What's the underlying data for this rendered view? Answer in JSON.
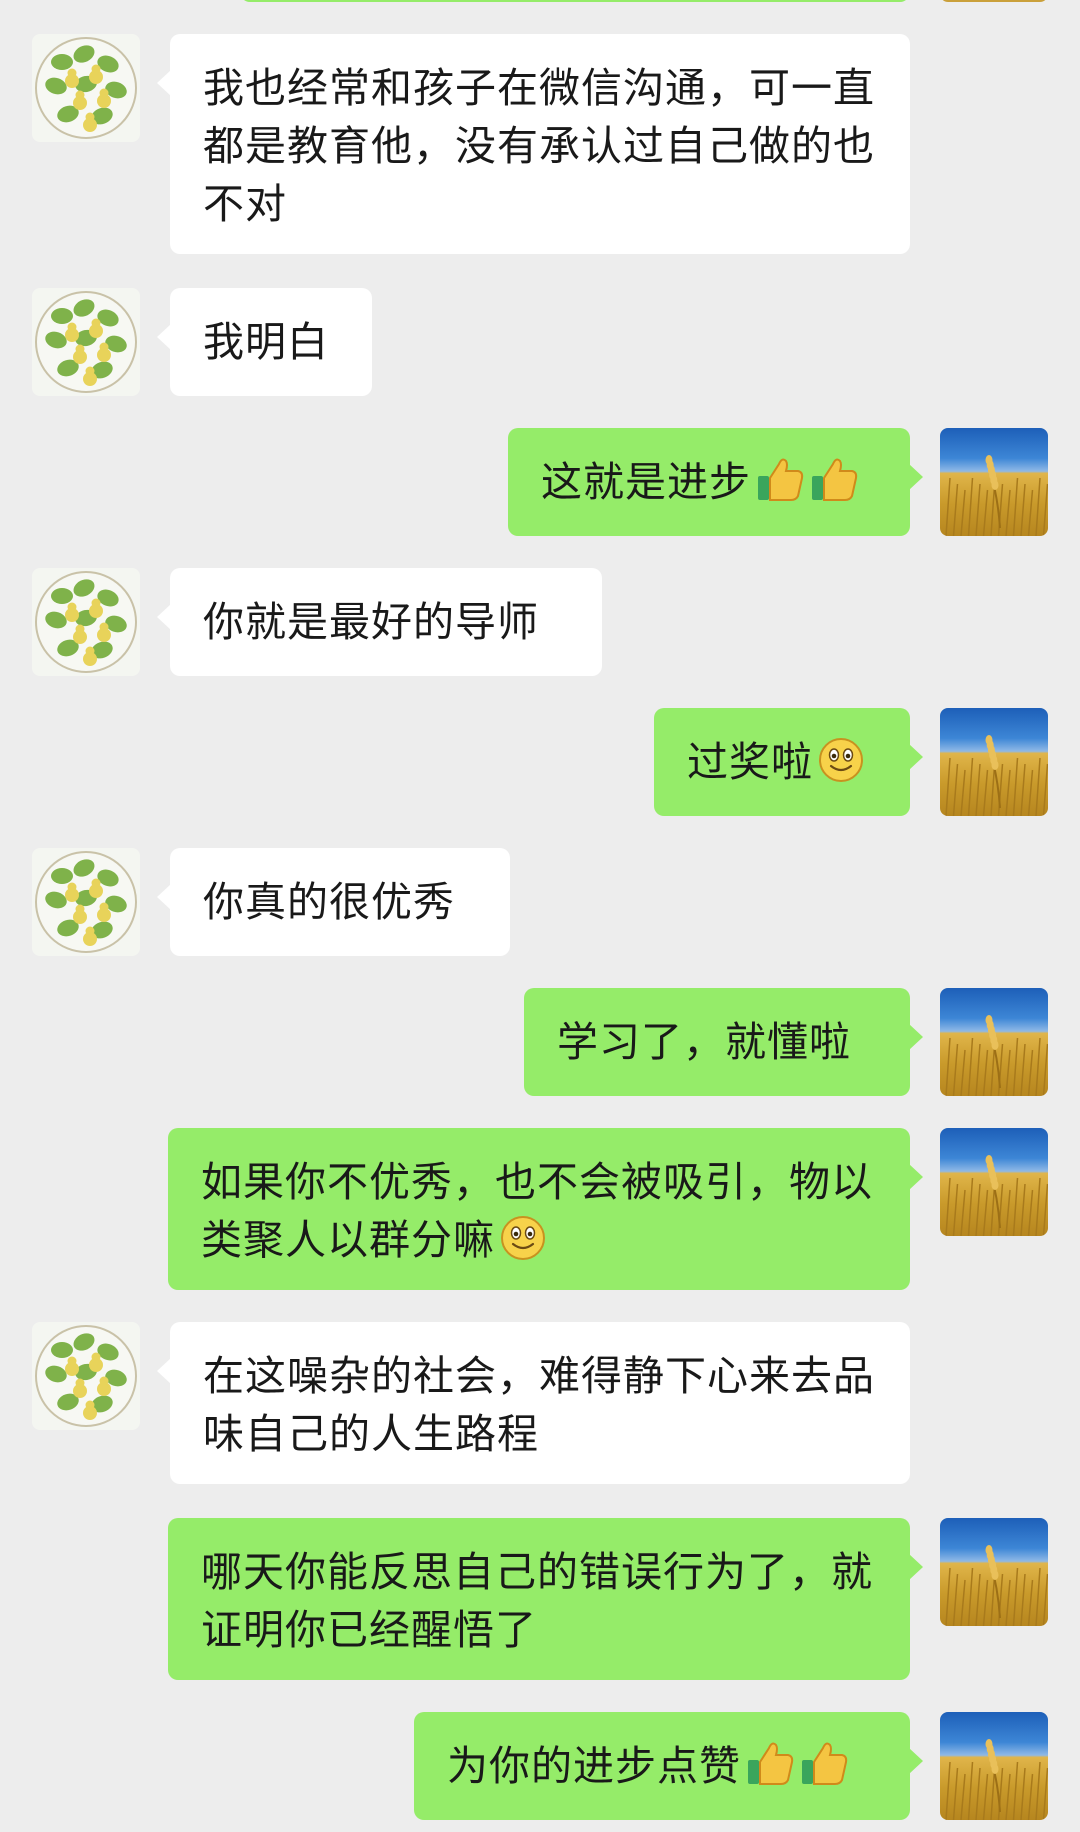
{
  "messages": [
    {
      "side": "in",
      "text": "我也经常和孩子在微信沟通，可一直都是教育他，没有承认过自己做的也不对"
    },
    {
      "side": "in",
      "text": "我明白"
    },
    {
      "side": "out",
      "text": "这就是进步",
      "emoji": [
        "thumbs-up",
        "thumbs-up"
      ]
    },
    {
      "side": "in",
      "text": "你就是最好的导师"
    },
    {
      "side": "out",
      "text": "过奖啦",
      "emoji": [
        "smile"
      ]
    },
    {
      "side": "in",
      "text": "你真的很优秀"
    },
    {
      "side": "out",
      "text": "学习了，就懂啦"
    },
    {
      "side": "out",
      "text": "如果你不优秀，也不会被吸引，物以类聚人以群分嘛",
      "emoji": [
        "smile"
      ]
    },
    {
      "side": "in",
      "text": "在这噪杂的社会，难得静下心来去品味自己的人生路程"
    },
    {
      "side": "out",
      "text": "哪天你能反思自己的错误行为了，就证明你已经醒悟了"
    },
    {
      "side": "out",
      "text": "为你的进步点赞",
      "emoji": [
        "thumbs-up",
        "thumbs-up"
      ]
    }
  ],
  "avatars": {
    "incoming": "gourd-plant-avatar",
    "outgoing": "wheat-field-avatar"
  },
  "colors": {
    "background": "#ededed",
    "incoming_bubble": "#ffffff",
    "outgoing_bubble": "#95ec69",
    "text": "#191919"
  }
}
